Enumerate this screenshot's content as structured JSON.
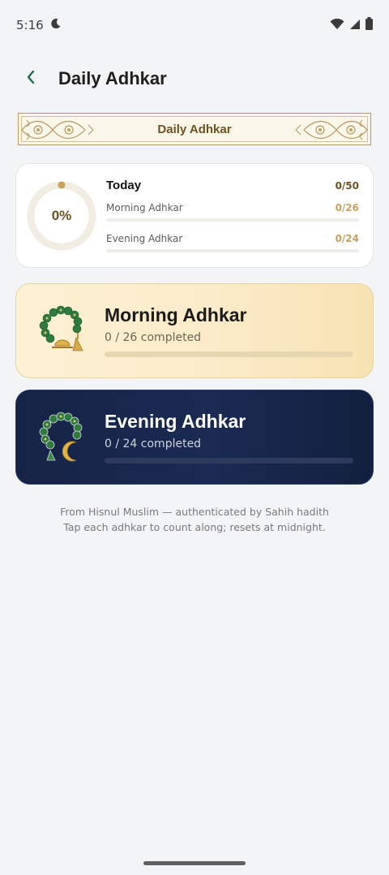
{
  "status_bar": {
    "time": "5:16",
    "icons": [
      "moon-icon",
      "wifi-icon",
      "signal-icon",
      "battery-icon"
    ]
  },
  "app_bar": {
    "back_icon": "chevron-left-icon",
    "title": "Daily Adhkar"
  },
  "banner": {
    "title": "Daily Adhkar"
  },
  "summary": {
    "percent_label": "0%",
    "progress_fraction": 0,
    "today_label": "Today",
    "today_count": "0/50",
    "morning_label": "Morning Adhkar",
    "morning_count": "0/26",
    "morning_fraction": 0,
    "evening_label": "Evening Adhkar",
    "evening_count": "0/24",
    "evening_fraction": 0
  },
  "sessions": [
    {
      "title": "Morning Adhkar",
      "progress_text": "0 / 26 completed",
      "progress_fraction": 0,
      "icon": "prayer-beads-sun-icon"
    },
    {
      "title": "Evening Adhkar",
      "progress_text": "0 / 24 completed",
      "progress_fraction": 0,
      "icon": "prayer-beads-moon-icon"
    }
  ],
  "footer": {
    "line1": "From Hisnul Muslim — authenticated by Sahih hadith",
    "line2": "Tap each adhkar to count along; resets at midnight."
  },
  "colors": {
    "accent_gold": "#c7a35b",
    "accent_brown": "#6b5323",
    "back_green": "#1f6b4a",
    "evening_navy": "#162346",
    "morning_cream": "#fbebc9"
  }
}
